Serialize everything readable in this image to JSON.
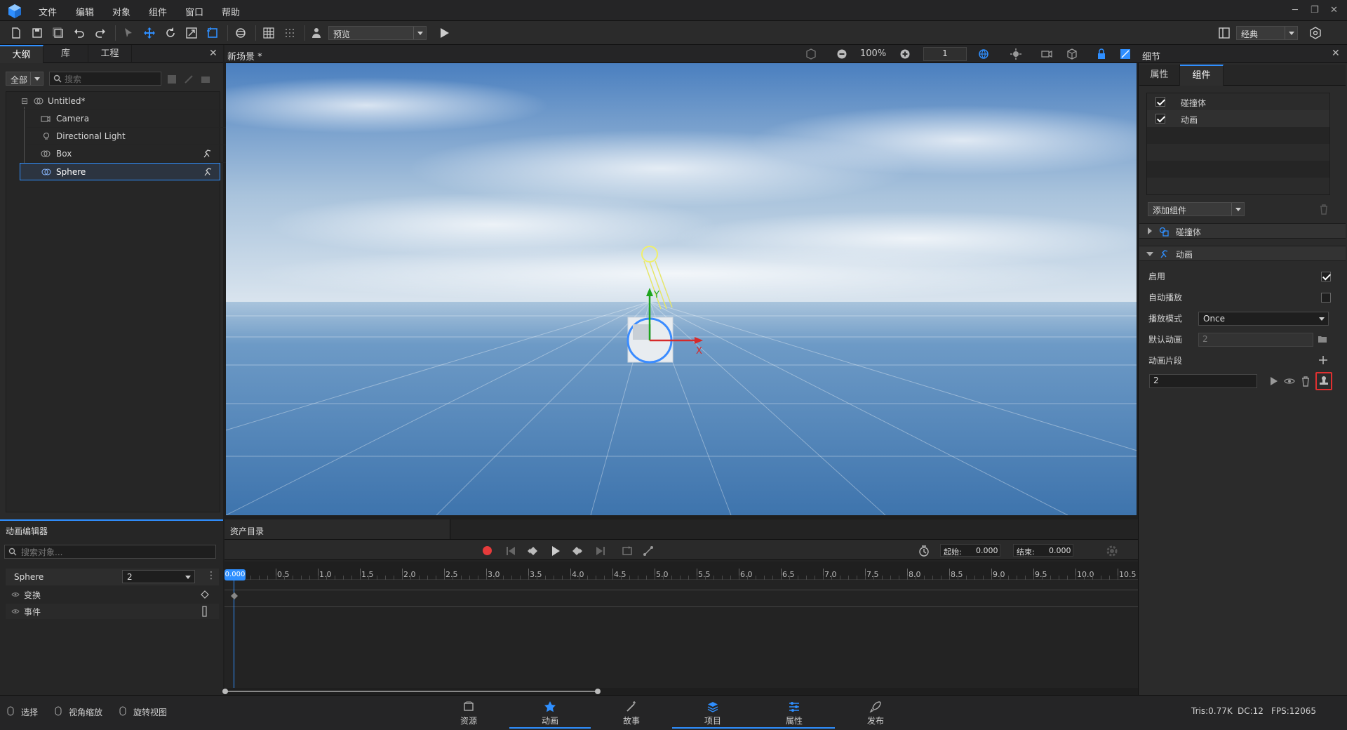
{
  "menubar": {
    "items": [
      "文件",
      "编辑",
      "对象",
      "组件",
      "窗口",
      "帮助"
    ]
  },
  "toolbar": {
    "preview_select": "预览",
    "layout_select": "经典"
  },
  "outline_panel": {
    "tabs": [
      "大纲",
      "库",
      "工程"
    ],
    "filter_select": "全部",
    "search_placeholder": "搜索",
    "tree": [
      {
        "label": "Untitled*"
      },
      {
        "label": "Camera"
      },
      {
        "label": "Directional Light"
      },
      {
        "label": "Box"
      },
      {
        "label": "Sphere"
      }
    ]
  },
  "scene": {
    "tab_title": "新场景 *",
    "zoom": "100%",
    "frame_field": "1",
    "axis_y": "Y",
    "axis_x": "X",
    "sky_top": "#4a7fbf",
    "sky_mid": "#c9d8e6",
    "ground": "#4f84b8"
  },
  "details_panel": {
    "title": "细节",
    "tabs": [
      "属性",
      "组件"
    ],
    "component_list": [
      {
        "label": "碰撞体",
        "checked": true
      },
      {
        "label": "动画",
        "checked": true
      }
    ],
    "add_component": "添加组件",
    "sections": [
      {
        "label": "碰撞体",
        "expanded": false
      },
      {
        "label": "动画",
        "expanded": true
      }
    ],
    "properties": {
      "enable_label": "启用",
      "enable_checked": true,
      "autoplay_label": "自动播放",
      "autoplay_checked": false,
      "play_mode_label": "播放模式",
      "play_mode_value": "Once",
      "default_anim_label": "默认动画",
      "default_anim_value": "2",
      "clips_label": "动画片段",
      "clip_value": "2"
    }
  },
  "anim_editor": {
    "title": "动画编辑器",
    "assets_tab": "资产目录",
    "search_placeholder": "搜索对象...",
    "object_name": "Sphere",
    "clip_select": "2",
    "tracks": [
      "变换",
      "事件"
    ],
    "start_label": "起始:",
    "start_value": "0.000",
    "end_label": "结束:",
    "end_value": "0.000",
    "playhead": "0.000",
    "ticks": [
      "0.5",
      "1.0",
      "1.5",
      "2.0",
      "2.5",
      "3.0",
      "3.5",
      "4.0",
      "4.5",
      "5.0",
      "5.5",
      "6.0",
      "6.5",
      "7.0",
      "7.5",
      "8.0",
      "8.5",
      "9.0",
      "9.5",
      "10.0",
      "10.5"
    ]
  },
  "bottom_bar": {
    "tools": [
      "选择",
      "视角缩放",
      "旋转视图"
    ],
    "tabs": [
      {
        "label": "资源",
        "active": false
      },
      {
        "label": "动画",
        "active": true
      },
      {
        "label": "故事",
        "active": false
      },
      {
        "label": "项目",
        "active": true
      },
      {
        "label": "属性",
        "active": true
      },
      {
        "label": "发布",
        "active": false
      }
    ],
    "stats": {
      "tris": "Tris:0.77K",
      "dc": "DC:12",
      "fps": "FPS:12065"
    }
  },
  "colors": {
    "accent": "#2f8fff",
    "record": "#e63b3b",
    "highlight_box": "#e03030"
  }
}
